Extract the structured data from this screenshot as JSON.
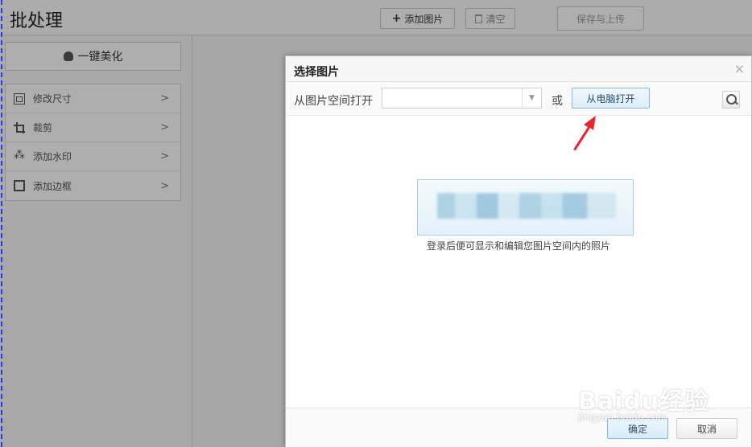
{
  "app": {
    "title": "批处理",
    "toolbar": {
      "add_image_label": "添加图片",
      "clear_label": "清空",
      "save_upload_label": "保存与上传"
    },
    "sidebar": {
      "beautify_label": "一键美化",
      "items": [
        {
          "label": "修改尺寸",
          "icon": "resize-icon"
        },
        {
          "label": "裁剪",
          "icon": "crop-icon"
        },
        {
          "label": "添加水印",
          "icon": "watermark-icon"
        },
        {
          "label": "添加边框",
          "icon": "border-icon"
        }
      ]
    }
  },
  "dialog": {
    "title": "选择图片",
    "close_glyph": "×",
    "open_from_space_label": "从图片空间打开",
    "space_select_value": "",
    "or_label": "或",
    "open_from_pc_label": "从电脑打开",
    "login_hint": "登录后便可显示和编辑您图片空间内的照片",
    "ok_label": "确定",
    "cancel_label": "取消"
  },
  "watermark": {
    "text": "Baidu经验",
    "sub": "jingyan.baidu.com"
  },
  "colors": {
    "annotation_arrow": "#e8262d",
    "dashed_border": "#2b3fd8",
    "primary_button_border": "#86b7d8"
  }
}
